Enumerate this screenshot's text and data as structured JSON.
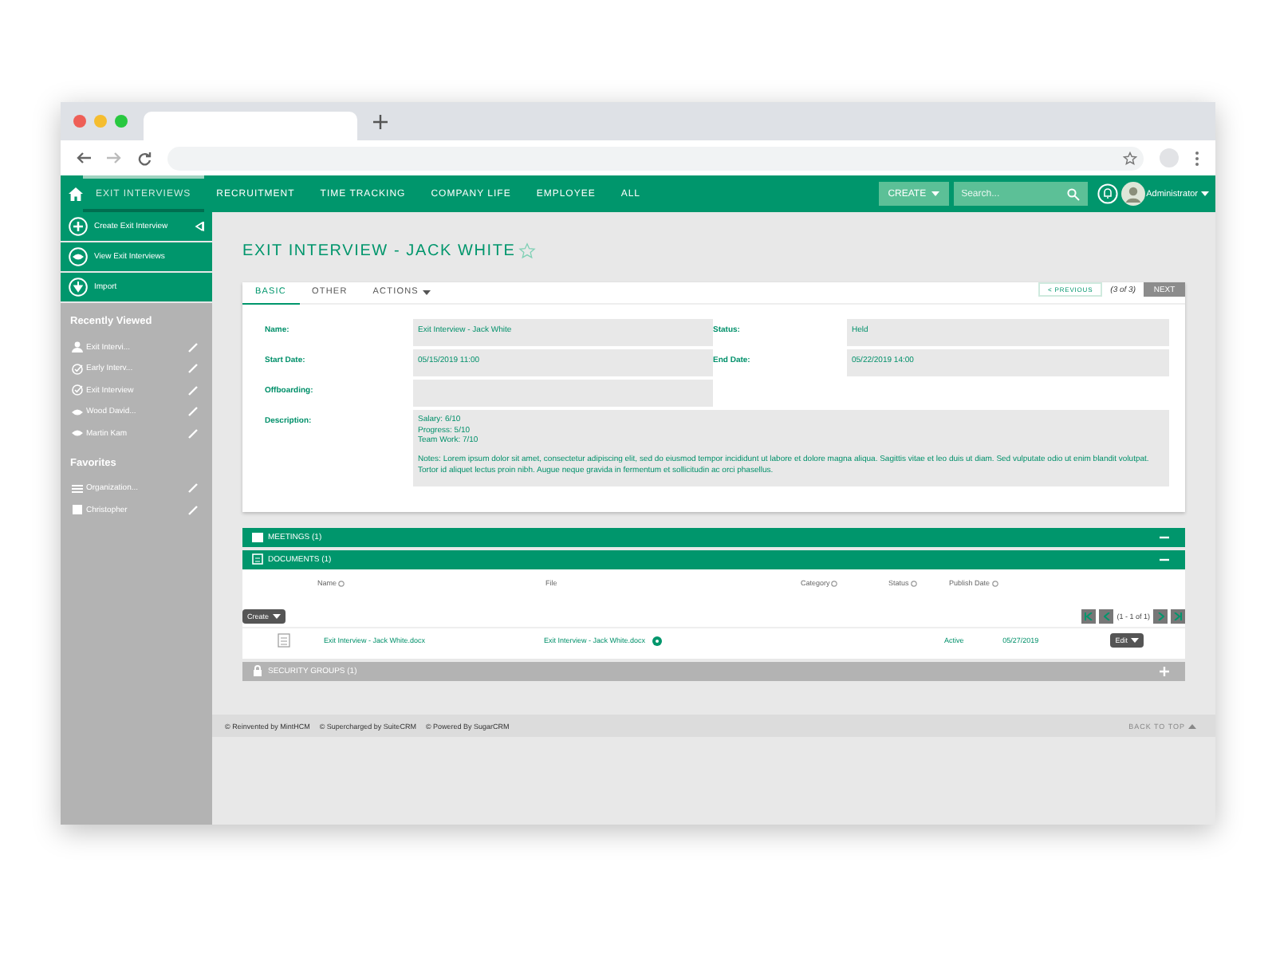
{
  "nav": {
    "items": [
      {
        "label": "EXIT INTERVIEWS",
        "selected": true
      },
      {
        "label": "RECRUITMENT",
        "selected": false
      },
      {
        "label": "TIME TRACKING",
        "selected": false
      },
      {
        "label": "COMPANY LIFE",
        "selected": false
      },
      {
        "label": "EMPLOYEE",
        "selected": false
      },
      {
        "label": "ALL",
        "selected": false
      }
    ],
    "create_button": "CREATE",
    "search": {
      "placeholder": "Search..."
    },
    "user": "Administrator"
  },
  "sidebar": {
    "actions": [
      {
        "label": "Create Exit Interview",
        "kind": "create"
      },
      {
        "label": "View Exit Interviews",
        "kind": "view"
      },
      {
        "label": "Import",
        "kind": "import"
      }
    ],
    "recent_title": "Recently Viewed",
    "recent": [
      {
        "label": "Exit Intervi...",
        "kind": "person"
      },
      {
        "label": "Early Interv...",
        "kind": "interview"
      },
      {
        "label": "Exit Interview",
        "kind": "interview"
      },
      {
        "label": "Wood David...",
        "kind": "employee"
      },
      {
        "label": "Martin Kam",
        "kind": "employee"
      }
    ],
    "favorites_title": "Favorites",
    "favorites": [
      {
        "label": "Organization...",
        "kind": "list"
      },
      {
        "label": "Christopher",
        "kind": "contact"
      }
    ]
  },
  "detail": {
    "title": "EXIT INTERVIEW - JACK WHITE",
    "tabs": [
      {
        "label": "BASIC",
        "selected": true,
        "kind": "tab"
      },
      {
        "label": "OTHER",
        "selected": false,
        "kind": "tab"
      },
      {
        "label": "ACTIONS",
        "selected": false,
        "kind": "menu"
      }
    ],
    "pager": {
      "previous": "< PREVIOUS",
      "count": "(3 of 3)",
      "next": "NEXT",
      "next_disabled": true
    },
    "rows": [
      [
        {
          "label": "Name:",
          "value": "Exit Interview - Jack White"
        },
        {
          "label": "Status:",
          "value": "Held"
        }
      ],
      [
        {
          "label": "Start Date:",
          "value": "05/15/2019 11:00"
        },
        {
          "label": "End Date:",
          "value": "05/22/2019 14:00"
        }
      ],
      [
        {
          "label": "Offboarding:"
        }
      ]
    ],
    "description": {
      "label": "Description:",
      "lines": [
        "Salary: 6/10",
        "Progress: 5/10",
        "Team Work: 7/10"
      ],
      "notes": "Notes: Lorem ipsum dolor sit amet, consectetur adipiscing elit, sed do eiusmod tempor incididunt ut labore et dolore magna aliqua. Sagittis vitae et leo duis ut diam. Sed vulputate odio ut enim blandit volutpat. Tortor id aliquet lectus proin nibh. Augue neque gravida in fermentum et sollicitudin ac orci phasellus."
    }
  },
  "panels": [
    {
      "title": "MEETINGS (1)",
      "expanded": true,
      "kind": "meetings"
    },
    {
      "title": "DOCUMENTS (1)",
      "expanded": true,
      "kind": "documents"
    },
    {
      "title": "SECURITY GROUPS (1)",
      "expanded": false,
      "kind": "security"
    }
  ],
  "documents": {
    "columns": [
      "Name",
      "File",
      "Category",
      "Status",
      "Publish Date"
    ],
    "create_button": "Create",
    "pagination": "(1 - 1 of 1)",
    "rows": [
      {
        "name": "Exit Interview - Jack White.docx",
        "file": "Exit Interview - Jack White.docx",
        "status": "Active",
        "publish_date": "05/27/2019",
        "edit_button": "Edit"
      }
    ]
  },
  "footer": {
    "credits": [
      "© Reinvented by MintHCM",
      "© Supercharged by SuiteCRM",
      "© Powered By SugarCRM"
    ],
    "back_to_top": "BACK TO TOP"
  }
}
